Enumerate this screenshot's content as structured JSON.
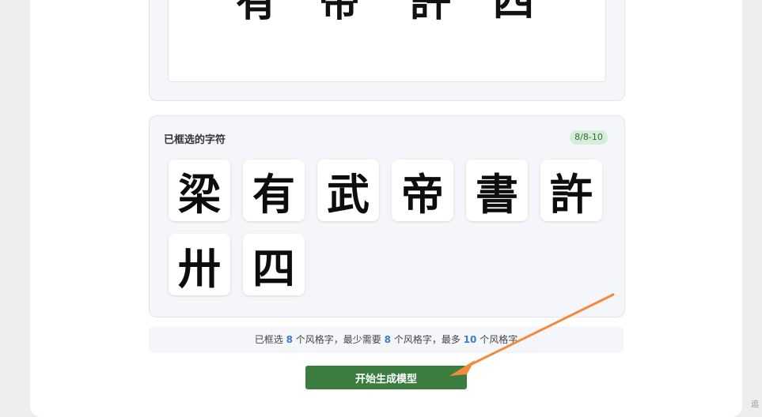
{
  "preview": {
    "glyphs": [
      "有",
      "帝",
      "許",
      "四"
    ]
  },
  "selected": {
    "title": "已框选的字符",
    "badge": "8/8-10",
    "characters": [
      "梁",
      "有",
      "武",
      "帝",
      "書",
      "許",
      "卅",
      "四"
    ]
  },
  "info": {
    "prefix": "已框选",
    "selected_count": "8",
    "middle1": "个风格字，最少需要",
    "min_count": "8",
    "middle2": "个风格字，最多",
    "max_count": "10",
    "suffix": "个风格字"
  },
  "actions": {
    "start_label": "开始生成模型"
  },
  "annotation": {
    "arrow_color": "#f08a3c"
  },
  "corner": {
    "text": "追"
  }
}
